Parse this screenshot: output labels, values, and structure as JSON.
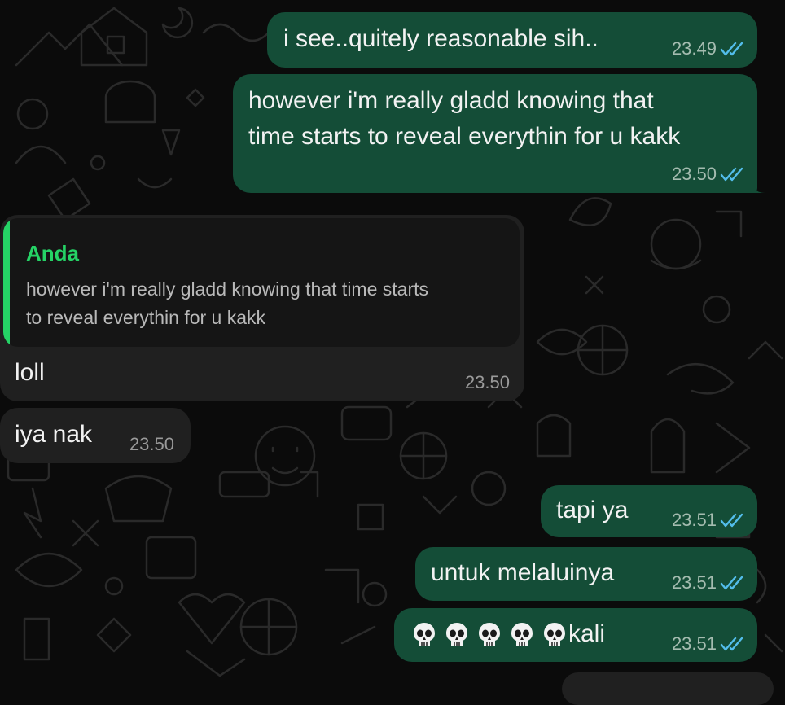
{
  "colors": {
    "outgoing_bubble": "#144d37",
    "incoming_bubble": "#202020",
    "quote_accent": "#25d366",
    "read_ticks": "#53bdeb",
    "background": "#0b0b0b"
  },
  "messages": [
    {
      "direction": "outgoing",
      "text": "i see..quitely reasonable sih..",
      "time": "23.49",
      "status": "read"
    },
    {
      "direction": "outgoing",
      "text_lines": [
        "however i'm really gladd knowing that",
        "time starts to reveal everythin for u kakk"
      ],
      "time": "23.50",
      "status": "read"
    },
    {
      "direction": "incoming",
      "reply_to": {
        "author": "Anda",
        "text_lines": [
          "however i'm really gladd knowing that time starts",
          "to reveal everythin for u kakk"
        ]
      },
      "text": "loll",
      "time": "23.50"
    },
    {
      "direction": "incoming",
      "text": "iya nak",
      "time": "23.50"
    },
    {
      "direction": "outgoing",
      "text": "tapi ya",
      "time": "23.51",
      "status": "read"
    },
    {
      "direction": "outgoing",
      "text": "untuk melaluinya",
      "time": "23.51",
      "status": "read"
    },
    {
      "direction": "outgoing",
      "emoji": [
        "skull-emoji",
        "skull-emoji",
        "skull-emoji",
        "skull-emoji",
        "skull-emoji"
      ],
      "text": "kali",
      "time": "23.51",
      "status": "read"
    }
  ]
}
